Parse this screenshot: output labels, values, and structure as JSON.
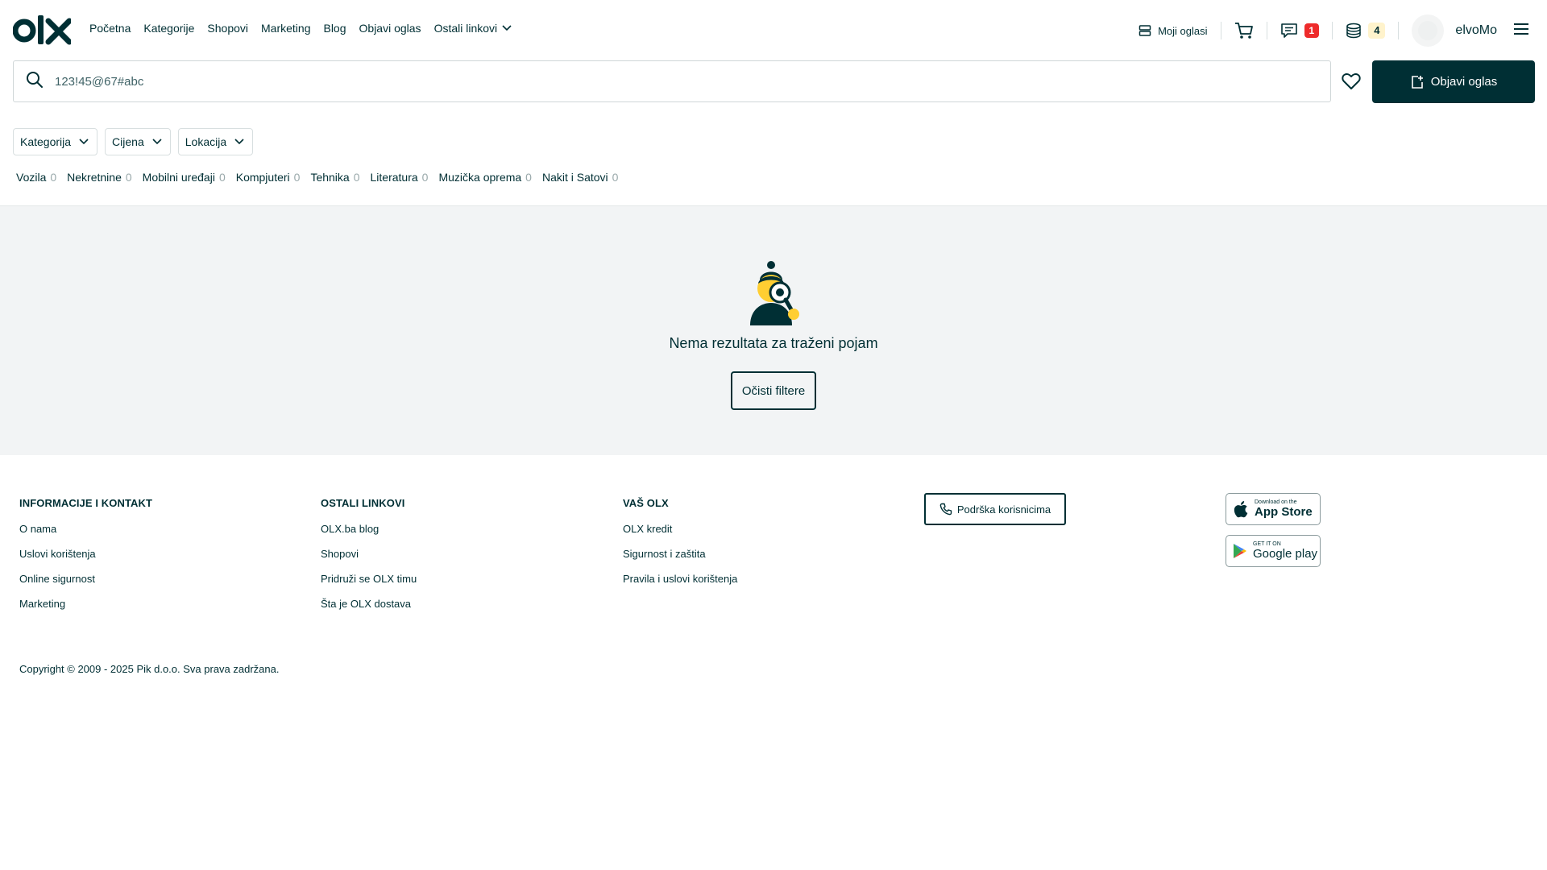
{
  "nav": {
    "items": [
      "Početna",
      "Kategorije",
      "Shopovi",
      "Marketing",
      "Blog",
      "Objavi oglas"
    ],
    "more_label": "Ostali linkovi"
  },
  "header": {
    "my_ads_label": "Moji oglasi",
    "messages_count": "1",
    "credits_count": "4",
    "username": "elvoMo"
  },
  "search": {
    "value": "123!45@67#abc",
    "post_button_label": "Objavi oglas"
  },
  "filters": {
    "items": [
      {
        "label": "Kategorija"
      },
      {
        "label": "Cijena"
      },
      {
        "label": "Lokacija"
      }
    ]
  },
  "categories": [
    {
      "label": "Vozila",
      "count": "0"
    },
    {
      "label": "Nekretnine",
      "count": "0"
    },
    {
      "label": "Mobilni uređaji",
      "count": "0"
    },
    {
      "label": "Kompjuteri",
      "count": "0"
    },
    {
      "label": "Tehnika",
      "count": "0"
    },
    {
      "label": "Literatura",
      "count": "0"
    },
    {
      "label": "Muzička oprema",
      "count": "0"
    },
    {
      "label": "Nakit i Satovi",
      "count": "0"
    }
  ],
  "empty": {
    "title": "Nema rezultata za traženi pojam",
    "clear_button": "Očisti filtere"
  },
  "footer": {
    "col1": {
      "title": "INFORMACIJE I KONTAKT",
      "links": [
        "O nama",
        "Uslovi korištenja",
        "Online sigurnost",
        "Marketing"
      ]
    },
    "col2": {
      "title": "OSTALI LINKOVI",
      "links": [
        "OLX.ba blog",
        "Shopovi",
        "Pridruži se OLX timu",
        "Šta je OLX dostava"
      ]
    },
    "col3": {
      "title": "VAŠ OLX",
      "links": [
        "OLX kredit",
        "Sigurnost i zaštita",
        "Pravila i uslovi korištenja"
      ]
    },
    "support_label": "Podrška korisnicima",
    "app_store": {
      "small": "Download on the",
      "big": "App Store"
    },
    "google_play": {
      "small": "GET IT ON",
      "big": "Google play"
    },
    "copyright": "Copyright © 2009 - 2025 Pik d.o.o. Sva prava zadržana."
  },
  "colors": {
    "brand_dark": "#002f34",
    "badge_red": "#ee2b2b",
    "badge_yellow_bg": "#fff3cc",
    "empty_bg": "#f2f4f5"
  },
  "icons": [
    "olx-logo",
    "chevron-down-icon",
    "list-icon",
    "cart-icon",
    "chat-icon",
    "coins-icon",
    "avatar",
    "menu-icon",
    "search-icon",
    "heart-icon",
    "add-post-icon",
    "phone-icon",
    "apple-icon",
    "google-play-icon"
  ]
}
